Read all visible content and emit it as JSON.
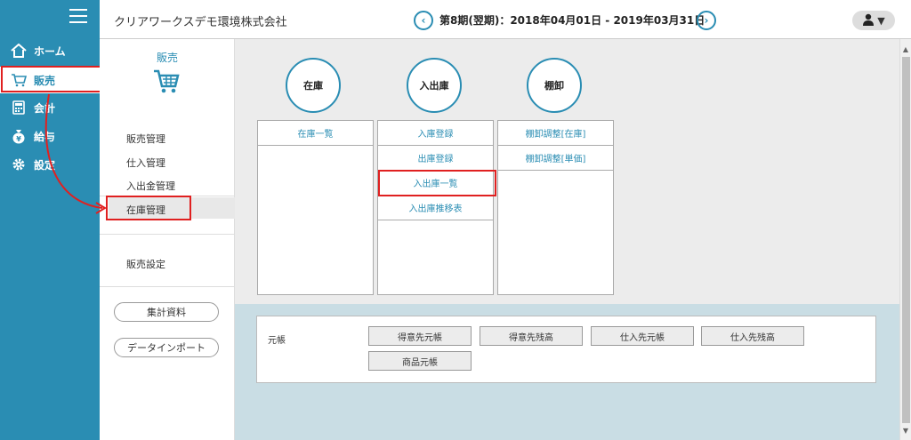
{
  "nav": {
    "items": [
      {
        "label": "ホーム",
        "icon": "home-icon"
      },
      {
        "label": "販売",
        "icon": "cart-icon"
      },
      {
        "label": "会計",
        "icon": "calculator-icon"
      },
      {
        "label": "給与",
        "icon": "money-bag-icon"
      },
      {
        "label": "設定",
        "icon": "gear-icon"
      }
    ]
  },
  "header": {
    "company": "クリアワークスデモ環境株式会社",
    "period": "第8期(翌期)：2018年04月01日 - 2019年03月31日"
  },
  "subpanel": {
    "title": "販売",
    "links": [
      "販売管理",
      "仕入管理",
      "入出金管理",
      "在庫管理"
    ],
    "settings": "販売設定",
    "buttons": [
      "集計資料",
      "データインポート"
    ]
  },
  "categories": [
    {
      "title": "在庫",
      "items": [
        "在庫一覧"
      ]
    },
    {
      "title": "入出庫",
      "items": [
        "入庫登録",
        "出庫登録",
        "入出庫一覧",
        "入出庫推移表"
      ]
    },
    {
      "title": "棚卸",
      "items": [
        "棚卸調整[在庫]",
        "棚卸調整[単価]"
      ]
    }
  ],
  "ledger": {
    "label": "元帳",
    "buttons": [
      "得意先元帳",
      "得意先残高",
      "仕入先元帳",
      "仕入先残高",
      "商品元帳"
    ]
  },
  "colors": {
    "brand": "#2a8db3",
    "highlight": "#e02020"
  }
}
